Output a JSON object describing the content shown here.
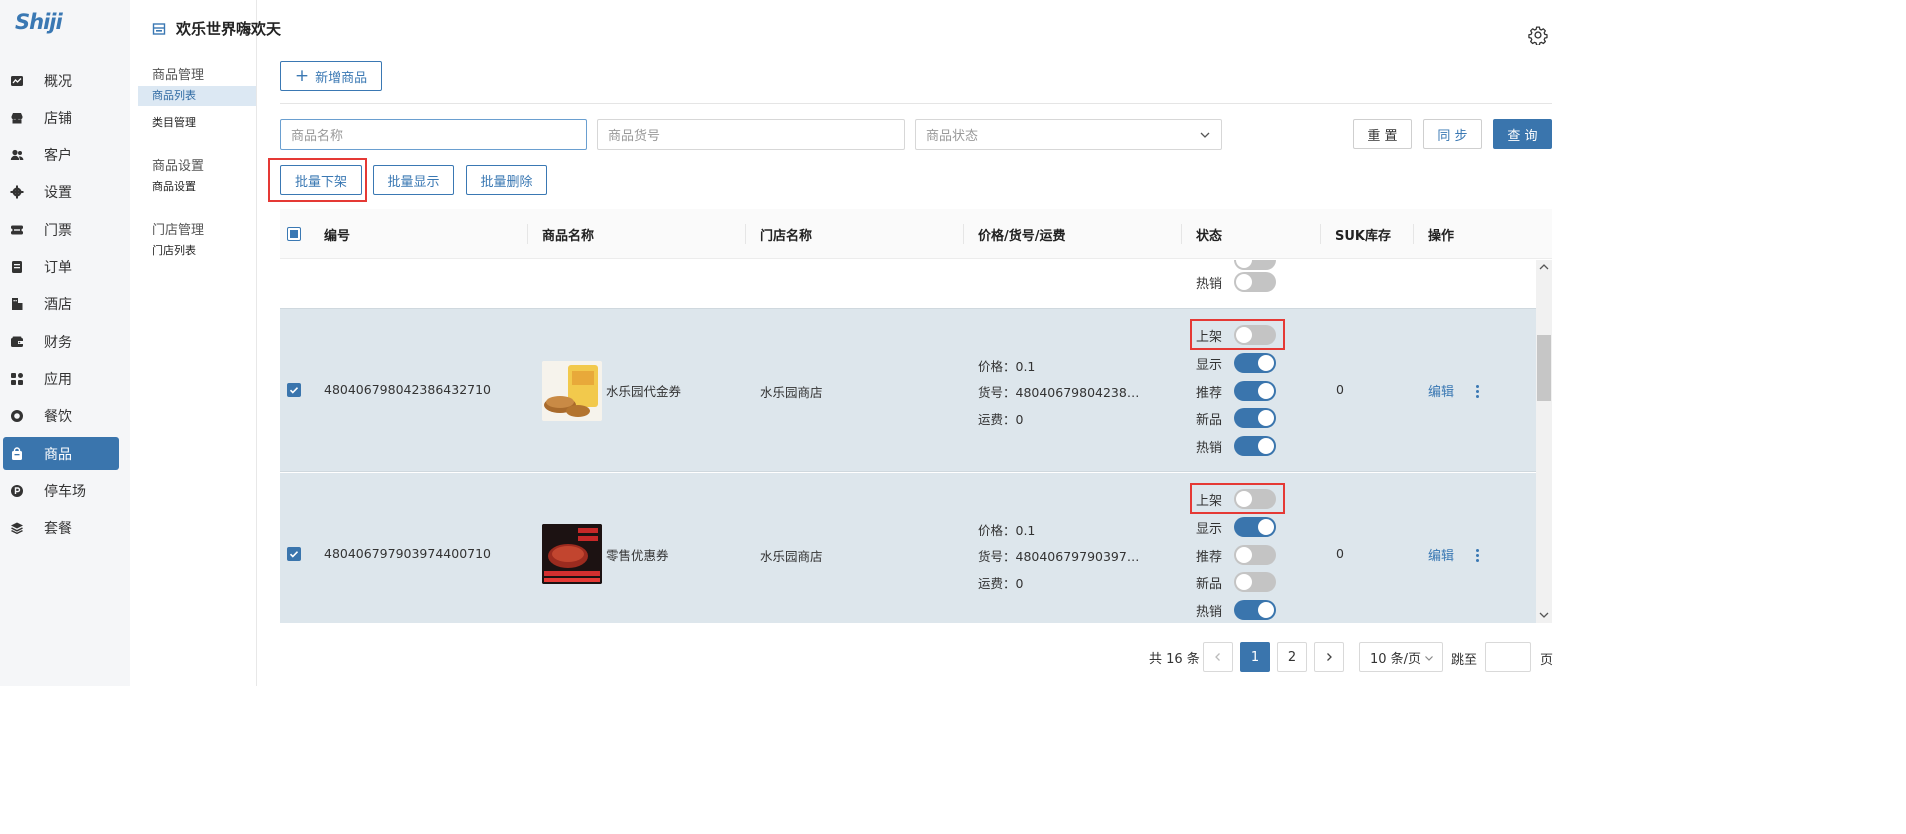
{
  "logo_text": "Shiji",
  "nav": {
    "items": [
      {
        "label": "概况",
        "icon": "chart-icon"
      },
      {
        "label": "店铺",
        "icon": "store-icon"
      },
      {
        "label": "客户",
        "icon": "users-icon"
      },
      {
        "label": "设置",
        "icon": "gear-icon"
      },
      {
        "label": "门票",
        "icon": "ticket-icon"
      },
      {
        "label": "订单",
        "icon": "order-icon"
      },
      {
        "label": "酒店",
        "icon": "hotel-icon"
      },
      {
        "label": "财务",
        "icon": "wallet-icon"
      },
      {
        "label": "应用",
        "icon": "apps-icon"
      },
      {
        "label": "餐饮",
        "icon": "dining-icon"
      },
      {
        "label": "商品",
        "icon": "bag-icon",
        "active": true
      },
      {
        "label": "停车场",
        "icon": "parking-icon"
      },
      {
        "label": "套餐",
        "icon": "layers-icon"
      }
    ]
  },
  "subnav": {
    "groups": [
      {
        "title": "商品管理",
        "items": [
          {
            "label": "商品列表",
            "active": true
          },
          {
            "label": "类目管理"
          }
        ]
      },
      {
        "title": "商品设置",
        "items": [
          {
            "label": "商品设置"
          }
        ]
      },
      {
        "title": "门店管理",
        "items": [
          {
            "label": "门店列表"
          }
        ]
      }
    ]
  },
  "header": {
    "title": "欢乐世界嗨欢天"
  },
  "toolbar": {
    "add_label": "新增商品"
  },
  "filters": {
    "name_placeholder": "商品名称",
    "code_placeholder": "商品货号",
    "status_placeholder": "商品状态",
    "reset_label": "重 置",
    "sync_label": "同 步",
    "query_label": "查 询"
  },
  "batch": {
    "offshelf_label": "批量下架",
    "show_label": "批量显示",
    "delete_label": "批量删除"
  },
  "table": {
    "columns": [
      "编号",
      "商品名称",
      "门店名称",
      "价格/货号/运费",
      "状态",
      "SUK库存",
      "操作"
    ],
    "partial_row": {
      "status_label": "热销",
      "status_on": false
    },
    "rows": [
      {
        "id": "480406798042386432710",
        "name": "水乐园代金券",
        "store": "水乐园商店",
        "price_line": "价格：0.1",
        "code_line": "货号：48040679804238…",
        "freight_line": "运费：0",
        "statuses": [
          {
            "label": "上架",
            "on": false
          },
          {
            "label": "显示",
            "on": true
          },
          {
            "label": "推荐",
            "on": true
          },
          {
            "label": "新品",
            "on": true
          },
          {
            "label": "热销",
            "on": true
          }
        ],
        "stock": "0",
        "edit_label": "编辑"
      },
      {
        "id": "480406797903974400710",
        "name": "零售优惠券",
        "store": "水乐园商店",
        "price_line": "价格：0.1",
        "code_line": "货号：48040679790397…",
        "freight_line": "运费：0",
        "statuses": [
          {
            "label": "上架",
            "on": false
          },
          {
            "label": "显示",
            "on": true
          },
          {
            "label": "推荐",
            "on": false
          },
          {
            "label": "新品",
            "on": false
          },
          {
            "label": "热销",
            "on": true
          }
        ],
        "stock": "0",
        "edit_label": "编辑"
      }
    ]
  },
  "pagination": {
    "total_label": "共 16 条",
    "pages": [
      "1",
      "2"
    ],
    "current": "1",
    "page_size_label": "10 条/页",
    "jump_label": "跳至",
    "page_suffix": "页"
  },
  "colors": {
    "accent": "#3a75ad",
    "highlight": "#e53935",
    "selected_row": "#dde6ec"
  }
}
